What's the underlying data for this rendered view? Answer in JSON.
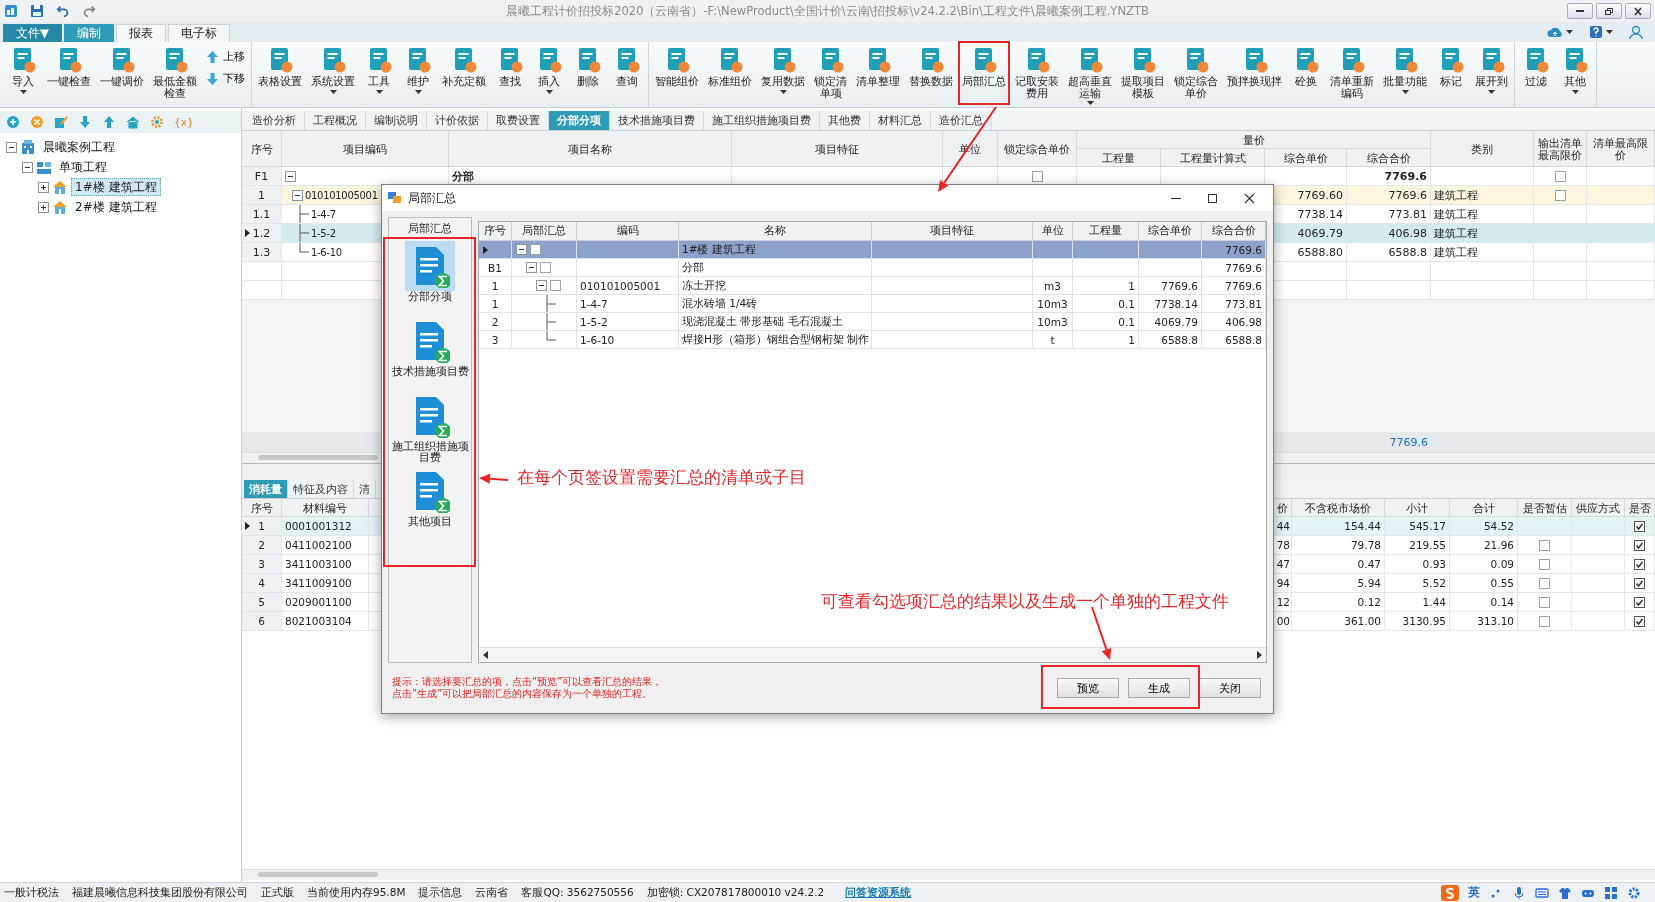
{
  "window": {
    "title": "晨曦工程计价招投标2020（云南省）-F:\\NewProduct\\全国计价\\云南\\招投标\\v24.2.2\\Bin\\工程文件\\晨曦案例工程.YNZTB"
  },
  "menu_tabs": [
    {
      "label": "文件▼",
      "kind": "file",
      "selected": false
    },
    {
      "label": "编制",
      "kind": "tab",
      "selected": true
    },
    {
      "label": "报表",
      "kind": "tab",
      "selected": false
    },
    {
      "label": "电子标",
      "kind": "tab",
      "selected": false
    }
  ],
  "ribbon": {
    "groups": [
      {
        "buttons": [
          {
            "label": "导入",
            "kind": "large",
            "has_menu": true
          },
          {
            "label": "一键检查",
            "kind": "large",
            "has_menu": false
          },
          {
            "label": "一键调价",
            "kind": "large",
            "has_menu": false
          },
          {
            "label_lines": [
              "最低金额",
              "检查"
            ],
            "kind": "large",
            "has_menu": false
          },
          {
            "label": "上移",
            "kind": "small",
            "has_menu": false
          },
          {
            "label": "下移",
            "kind": "small",
            "has_menu": false
          }
        ]
      },
      {
        "buttons": [
          {
            "label": "表格设置",
            "kind": "large",
            "has_menu": false
          },
          {
            "label": "系统设置",
            "kind": "large",
            "has_menu": true
          },
          {
            "label": "工具",
            "kind": "large",
            "has_menu": true
          },
          {
            "label": "维护",
            "kind": "large",
            "has_menu": true
          },
          {
            "label": "补充定额",
            "kind": "large",
            "has_menu": false
          },
          {
            "label": "查找",
            "kind": "large",
            "has_menu": false
          },
          {
            "label": "插入",
            "kind": "large",
            "has_menu": true
          },
          {
            "label": "删除",
            "kind": "large",
            "has_menu": false
          },
          {
            "label": "查询",
            "kind": "large",
            "has_menu": false
          }
        ]
      },
      {
        "buttons": [
          {
            "label": "智能组价",
            "kind": "large",
            "has_menu": false
          },
          {
            "label": "标准组价",
            "kind": "large",
            "has_menu": false
          },
          {
            "label": "复用数据",
            "kind": "large",
            "has_menu": true
          },
          {
            "label_lines": [
              "锁定清",
              "单项"
            ],
            "kind": "large",
            "has_menu": false
          },
          {
            "label": "清单整理",
            "kind": "large",
            "has_menu": false
          },
          {
            "label": "替换数据",
            "kind": "large",
            "has_menu": false
          },
          {
            "label": "局部汇总",
            "kind": "large",
            "has_menu": false
          },
          {
            "label_lines": [
              "记取安装",
              "费用"
            ],
            "kind": "large",
            "has_menu": false
          },
          {
            "label_lines": [
              "超高垂直",
              "运输"
            ],
            "kind": "large",
            "has_menu": true
          },
          {
            "label_lines": [
              "提取项目",
              "模板"
            ],
            "kind": "large",
            "has_menu": false
          },
          {
            "label_lines": [
              "锁定综合",
              "单价"
            ],
            "kind": "large",
            "has_menu": false
          },
          {
            "label": "预拌换现拌",
            "kind": "large",
            "has_menu": false
          },
          {
            "label": "砼换",
            "kind": "large",
            "has_menu": false
          },
          {
            "label_lines": [
              "清单重新",
              "编码"
            ],
            "kind": "large",
            "has_menu": false
          },
          {
            "label": "批量功能",
            "kind": "large",
            "has_menu": true
          },
          {
            "label": "标记",
            "kind": "large",
            "has_menu": false
          },
          {
            "label": "展开到",
            "kind": "large",
            "has_menu": true
          }
        ]
      },
      {
        "buttons": [
          {
            "label": "过滤",
            "kind": "large",
            "has_menu": false
          },
          {
            "label": "其他",
            "kind": "large",
            "has_menu": true
          }
        ]
      }
    ]
  },
  "left_toolbar": {
    "variable_label": "{x}"
  },
  "project_tree": {
    "items": [
      {
        "label": "晨曦案例工程",
        "kind": "project",
        "expanded": true,
        "selected": false,
        "children": [
          {
            "label": "单项工程",
            "kind": "group",
            "expanded": true,
            "selected": false,
            "children": [
              {
                "label": "1#楼 建筑工程",
                "kind": "unit",
                "expanded": false,
                "selected": true
              },
              {
                "label": "2#楼 建筑工程",
                "kind": "unit",
                "expanded": false,
                "selected": false
              }
            ]
          }
        ]
      }
    ]
  },
  "main_tabs": [
    {
      "label": "造价分析",
      "selected": false
    },
    {
      "label": "工程概况",
      "selected": false
    },
    {
      "label": "编制说明",
      "selected": false
    },
    {
      "label": "计价依据",
      "selected": false
    },
    {
      "label": "取费设置",
      "selected": false
    },
    {
      "label": "分部分项",
      "selected": true
    },
    {
      "label": "技术措施项目费",
      "selected": false
    },
    {
      "label": "施工组织措施项目费",
      "selected": false
    },
    {
      "label": "其他费",
      "selected": false
    },
    {
      "label": "材料汇总",
      "selected": false
    },
    {
      "label": "造价汇总",
      "selected": false
    }
  ],
  "main_table": {
    "columns": [
      {
        "label": "序号"
      },
      {
        "label": "项目编码"
      },
      {
        "label": "项目名称"
      },
      {
        "label": "项目特征"
      },
      {
        "label": "单位"
      },
      {
        "label": "锁定综合单价"
      },
      {
        "label": "工程量"
      },
      {
        "label": "工程量计算式"
      },
      {
        "label": "综合单价"
      },
      {
        "label": "综合合价"
      },
      {
        "label": "类别"
      },
      {
        "label": "输出清单最高限价"
      },
      {
        "label": "清单最高限价"
      }
    ],
    "group_header": {
      "label": "量价"
    },
    "rows": [
      {
        "seq": "F1",
        "kind": "section",
        "selected": false,
        "expanded": true,
        "name": "分部",
        "lock_checked": false,
        "total": "7769.6",
        "output_checked": false,
        "children": [
          {
            "seq": "1",
            "kind": "bill",
            "selected": false,
            "expanded": true,
            "code": "010101005001",
            "unit_price": "7769.60",
            "total": "7769.6",
            "category": "建筑工程",
            "output_checked": false,
            "children": [
              {
                "seq": "1.1",
                "selected": false,
                "code": "1-4-7",
                "unit_price": "7738.14",
                "total": "773.81",
                "category": "建筑工程"
              },
              {
                "seq": "1.2",
                "selected": true,
                "code": "1-5-2",
                "unit_price": "4069.79",
                "total": "406.98",
                "category": "建筑工程"
              },
              {
                "seq": "1.3",
                "selected": false,
                "code": "1-6-10",
                "unit_price": "6588.80",
                "total": "6588.8",
                "category": "建筑工程"
              }
            ]
          }
        ]
      }
    ],
    "footer": {
      "total": "7769.6"
    }
  },
  "bottom_tabs": [
    {
      "label": "消耗量",
      "selected": true
    },
    {
      "label": "特征及内容",
      "selected": false
    },
    {
      "label": "清",
      "selected": false
    }
  ],
  "material_table": {
    "columns": [
      {
        "label": "序号"
      },
      {
        "label": "材料编号"
      },
      {
        "label": "价"
      },
      {
        "label": "不含税市场价"
      },
      {
        "label": "小计"
      },
      {
        "label": "合计"
      },
      {
        "label": "是否暂估"
      },
      {
        "label": "供应方式"
      },
      {
        "label": "是否"
      }
    ],
    "rows": [
      {
        "seq": "1",
        "selected": true,
        "code": "0001001312",
        "column_3": "44",
        "market_price": "154.44",
        "subtotal": "545.17",
        "total": "54.52",
        "last_checked": true
      },
      {
        "seq": "2",
        "selected": false,
        "code": "0411002100",
        "column_3": "78",
        "market_price": "79.78",
        "subtotal": "219.55",
        "total": "21.96",
        "provisional_checked": false,
        "last_checked": true
      },
      {
        "seq": "3",
        "selected": false,
        "code": "3411003100",
        "column_3": "47",
        "market_price": "0.47",
        "subtotal": "0.93",
        "total": "0.09",
        "provisional_checked": false,
        "last_checked": true
      },
      {
        "seq": "4",
        "selected": false,
        "code": "3411009100",
        "column_3": "94",
        "market_price": "5.94",
        "subtotal": "5.52",
        "total": "0.55",
        "provisional_checked": false,
        "last_checked": true
      },
      {
        "seq": "5",
        "selected": false,
        "code": "0209001100",
        "column_3": "12",
        "market_price": "0.12",
        "subtotal": "1.44",
        "total": "0.14",
        "provisional_checked": false,
        "last_checked": true
      },
      {
        "seq": "6",
        "selected": false,
        "code": "8021003104",
        "column_3": "00",
        "market_price": "361.00",
        "subtotal": "3130.95",
        "total": "313.10",
        "provisional_checked": false,
        "last_checked": true
      }
    ]
  },
  "dialog": {
    "title": "局部汇总",
    "side_title": "局部汇总",
    "side_items": [
      {
        "label": "分部分项",
        "selected": true
      },
      {
        "label": "技术措施项目费",
        "selected": false
      },
      {
        "label": "施工组织措施项目费",
        "selected": false
      },
      {
        "label": "其他项目",
        "selected": false
      }
    ],
    "columns": [
      {
        "label": "序号"
      },
      {
        "label": "局部汇总"
      },
      {
        "label": "编码"
      },
      {
        "label": "名称"
      },
      {
        "label": "项目特征"
      },
      {
        "label": "单位"
      },
      {
        "label": "工程量"
      },
      {
        "label": "综合单价"
      },
      {
        "label": "综合合价"
      }
    ],
    "rows": [
      {
        "selected": true,
        "expanded": true,
        "checked": false,
        "name": "1#楼 建筑工程",
        "total": "7769.6",
        "children": [
          {
            "seq": "B1",
            "selected": false,
            "expanded": true,
            "checked": false,
            "name": "分部",
            "total": "7769.6",
            "children": [
              {
                "seq": "1",
                "selected": false,
                "expanded": true,
                "checked": false,
                "code": "010101005001",
                "name": "冻土开挖",
                "unit": "m3",
                "quantity": "1",
                "unit_price": "7769.6",
                "total": "7769.6",
                "children": [
                  {
                    "seq": "1",
                    "selected": false,
                    "code": "1-4-7",
                    "name": "混水砖墙 1/4砖",
                    "unit": "10m3",
                    "quantity": "0.1",
                    "unit_price": "7738.14",
                    "total": "773.81"
                  },
                  {
                    "seq": "2",
                    "selected": false,
                    "code": "1-5-2",
                    "name": "现浇混凝土 带形基础 毛石混凝土",
                    "unit": "10m3",
                    "quantity": "0.1",
                    "unit_price": "4069.79",
                    "total": "406.98"
                  },
                  {
                    "seq": "3",
                    "selected": false,
                    "code": "1-6-10",
                    "name": "焊接H形（箱形）钢组合型钢桁架 制作",
                    "unit": "t",
                    "quantity": "1",
                    "unit_price": "6588.8",
                    "total": "6588.8"
                  }
                ]
              }
            ]
          }
        ]
      }
    ],
    "hint_lines": [
      "提示：请选择要汇总的项，点击“预览”可以查看汇总的结果，",
      "点击“生成”可以把局部汇总的内容保存为一个单独的工程。"
    ],
    "buttons": [
      {
        "label": "预览"
      },
      {
        "label": "生成"
      },
      {
        "label": "关闭"
      }
    ]
  },
  "annotations": [
    {
      "text": "在每个页签设置需要汇总的清单或子目"
    },
    {
      "text": "可查看勾选项汇总的结果以及生成一个单独的工程文件"
    }
  ],
  "status_bar": {
    "items": [
      "一般计税法",
      "福建晨曦信息科技集团股份有限公司",
      "正式版",
      "当前使用内存95.8M",
      "提示信息",
      "云南省",
      "客服QQ: 3562750556",
      "加密锁: CX207817800010 v24.2.2"
    ],
    "link": "问答资源系统",
    "ime_label": "英"
  }
}
